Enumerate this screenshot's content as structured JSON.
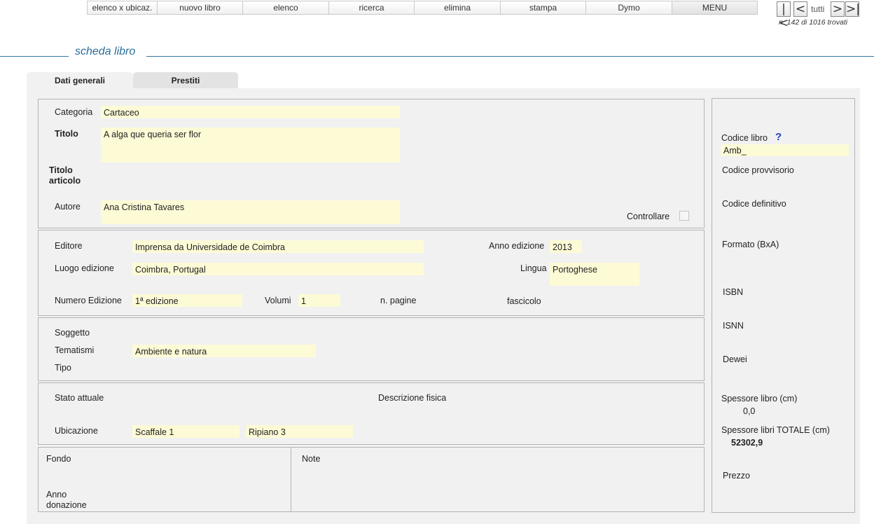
{
  "toolbar": {
    "buttons": [
      "elenco x ubicaz.",
      "nuovo libro",
      "elenco",
      "ricerca",
      "elimina",
      "stampa",
      "Dymo",
      "MENU"
    ]
  },
  "nav": {
    "first": "|<",
    "prev": "<",
    "all": "tutti",
    "next": ">",
    "last": ">|",
    "counter": "n. 142 di  1016 trovati"
  },
  "section_title": "scheda libro",
  "tabs": [
    "Dati generali",
    "Prestiti"
  ],
  "general": {
    "categoria_label": "Categoria",
    "categoria": "Cartaceo",
    "titolo_label": "Titolo",
    "titolo": "A alga que queria ser flor",
    "titolo_articolo_label_1": "Titolo",
    "titolo_articolo_label_2": "articolo",
    "autore_label": "Autore",
    "autore": "Ana Cristina Tavares",
    "controllare_label": "Controllare"
  },
  "edition": {
    "editore_label": "Editore",
    "editore": "Imprensa da Universidade de Coimbra",
    "anno_label": "Anno edizione",
    "anno": "2013",
    "luogo_label": "Luogo edizione",
    "luogo": "Coimbra, Portugal",
    "lingua_label": "Lingua",
    "lingua": "Portoghese",
    "numero_label": "Numero Edizione",
    "numero": "1ª edizione",
    "volumi_label": "Volumi",
    "volumi": "1",
    "pagine_label": "n. pagine",
    "fascicolo_label": "fascicolo"
  },
  "subject": {
    "soggetto_label": "Soggetto",
    "tematismi_label": "Tematismi",
    "tematismi": "Ambiente e natura",
    "tipo_label": "Tipo"
  },
  "status": {
    "stato_label": "Stato attuale",
    "descrizione_label": "Descrizione fisica",
    "ubicazione_label": "Ubicazione",
    "scaffale": "Scaffale 1",
    "ripiano": "Ripiano 3"
  },
  "bottom": {
    "fondo_label": "Fondo",
    "anno_donazione_label_1": "Anno",
    "anno_donazione_label_2": "donazione",
    "note_label": "Note"
  },
  "right": {
    "codice_libro_label": "Codice libro",
    "help": "?",
    "codice_libro": "Amb_",
    "codice_provv_label": "Codice provvisorio",
    "codice_def_label": "Codice definitivo",
    "formato_label": "Formato (BxA)",
    "isbn_label": "ISBN",
    "isnn_label": "ISNN",
    "dewei_label": "Dewei",
    "spessore_label": "Spessore libro (cm)",
    "spessore": "0,0",
    "spessore_tot_label": "Spessore libri TOTALE (cm)",
    "spessore_tot": "52302,9",
    "prezzo_label": "Prezzo"
  },
  "colors": {
    "accent": "#2a6d9c",
    "field_bg": "#fdfbd6",
    "panel_bg": "#f1f1f1",
    "help_icon": "#1d3fbf"
  }
}
